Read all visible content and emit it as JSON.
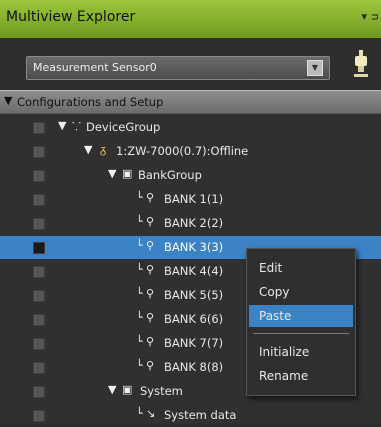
{
  "window": {
    "title": "Multiview Explorer",
    "pin_glyph": "▾",
    "close_glyph": "ᴝ"
  },
  "sensor_selector": {
    "value": "Measurement Sensor0",
    "arrow": "▼"
  },
  "tree": {
    "header": {
      "expander": "▼",
      "label": "Configurations and Setup"
    },
    "nodes": [
      {
        "expander": "▼",
        "icon": "⸪",
        "label": "DeviceGroup"
      },
      {
        "expander": "▼",
        "icon": "ᵹ",
        "label": "1:ZW-7000(0.7):Offline"
      },
      {
        "expander": "▼",
        "icon": "▣",
        "label": "BankGroup"
      },
      {
        "branch": "└",
        "icon": "⚲",
        "label": "BANK 1(1)"
      },
      {
        "branch": "└",
        "icon": "⚲",
        "label": "BANK 2(2)"
      },
      {
        "branch": "└",
        "icon": "⚲",
        "label": "BANK 3(3)"
      },
      {
        "branch": "└",
        "icon": "⚲",
        "label": "BANK 4(4)"
      },
      {
        "branch": "└",
        "icon": "⚲",
        "label": "BANK 5(5)"
      },
      {
        "branch": "└",
        "icon": "⚲",
        "label": "BANK 6(6)"
      },
      {
        "branch": "└",
        "icon": "⚲",
        "label": "BANK 7(7)"
      },
      {
        "branch": "└",
        "icon": "⚲",
        "label": "BANK 8(8)"
      },
      {
        "expander": "▼",
        "icon": "▣",
        "label": "System"
      },
      {
        "branch": "└",
        "icon": "↘",
        "label": "System data"
      }
    ]
  },
  "context_menu": {
    "items": [
      "Edit",
      "Copy",
      "Paste",
      "Initialize",
      "Rename"
    ],
    "highlighted": "Paste"
  },
  "colors": {
    "title_bar": "#7ea82b",
    "selection": "#3c83c6",
    "panel_bg": "#303030"
  }
}
